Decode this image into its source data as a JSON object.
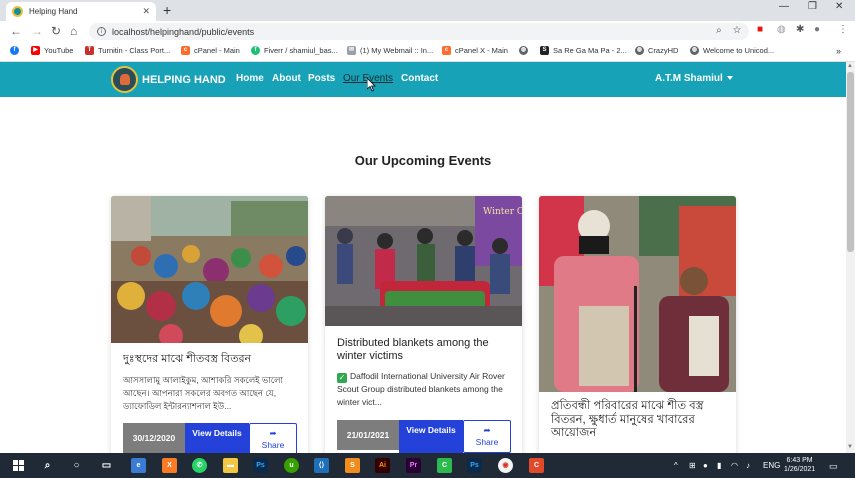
{
  "browser": {
    "tab_title": "Helping Hand",
    "tab_close": "✕",
    "new_tab": "+",
    "url": "localhost/helpinghand/public/events",
    "window_controls": [
      "—",
      "❐",
      "✕"
    ]
  },
  "bookmarks": [
    {
      "label": "",
      "color": "#1877f2",
      "icon": "facebook-icon"
    },
    {
      "label": "YouTube",
      "color": "#ff0000",
      "icon": "youtube-icon"
    },
    {
      "label": "Turnitin - Class Port...",
      "color": "#c9302c",
      "icon": "turnitin-icon"
    },
    {
      "label": "cPanel - Main",
      "color": "#ff6c2c",
      "icon": "cpanel-icon"
    },
    {
      "label": "Fiverr / shamiul_bas...",
      "color": "#1dbf73",
      "icon": "fiverr-icon"
    },
    {
      "label": "(1) My Webmail :: In...",
      "color": "#9aa0a6",
      "icon": "webmail-icon"
    },
    {
      "label": "cPanel X - Main",
      "color": "#ff6c2c",
      "icon": "cpanel-icon"
    },
    {
      "label": "",
      "color": "#5f6368",
      "icon": "globe-icon"
    },
    {
      "label": "Sa Re Ga Ma Pa - 2...",
      "color": "#222",
      "icon": "sarega-icon"
    },
    {
      "label": "CrazyHD",
      "color": "#5f6368",
      "icon": "globe-icon"
    },
    {
      "label": "Welcome to Unicod...",
      "color": "#5f6368",
      "icon": "globe-icon"
    }
  ],
  "site": {
    "brand": "HELPING HAND",
    "nav": [
      "Home",
      "About",
      "Posts",
      "Our Events",
      "Contact"
    ],
    "active_nav": "Our Events",
    "user": "A.T.M Shamiul",
    "heading": "Our Upcoming Events",
    "colors": {
      "navbar": "#17a2b8",
      "primary": "#2442d9",
      "date_badge": "#7d7d7d"
    }
  },
  "events": [
    {
      "title": "দুঃস্থদের মাঝে শীতবস্ত্র বিতরন",
      "description": "আসসালামু আলাইকুম, আশাকরি সকলেই ভালো আছেন। আপনারা সকলের অবগত আছেন যে, ড্যাফোডিল ইন্টারন্যাশনাল ইউ...",
      "date": "30/12/2020",
      "view_label": "View Details",
      "share_label": "Share"
    },
    {
      "title": "Distributed blankets among the winter victims",
      "description": "Daffodil International University Air Rover Scout Group distributed blankets among the winter vict...",
      "date": "21/01/2021",
      "view_label": "View Details",
      "share_label": "Share"
    },
    {
      "title": "প্রতিবন্ধী পরিবারের মাঝে শীত বস্ত্র বিতরন, ক্ষুধার্ত মানুষের খাবারের আয়োজন",
      "description": "",
      "date": "",
      "view_label": "",
      "share_label": ""
    }
  ],
  "taskbar": {
    "time": "6:43 PM",
    "date": "1/26/2021",
    "language": "ENG",
    "icons": [
      "search-icon",
      "cortana-icon",
      "task-view-icon",
      "edge-icon",
      "xampp-icon",
      "whatsapp-icon",
      "file-explorer-icon",
      "photoshop-icon",
      "upwork-icon",
      "vscode-icon",
      "sublime-icon",
      "illustrator-icon",
      "premiere-icon",
      "camtasia-icon",
      "photoshop-icon",
      "chrome-icon",
      "recorder-icon"
    ]
  }
}
